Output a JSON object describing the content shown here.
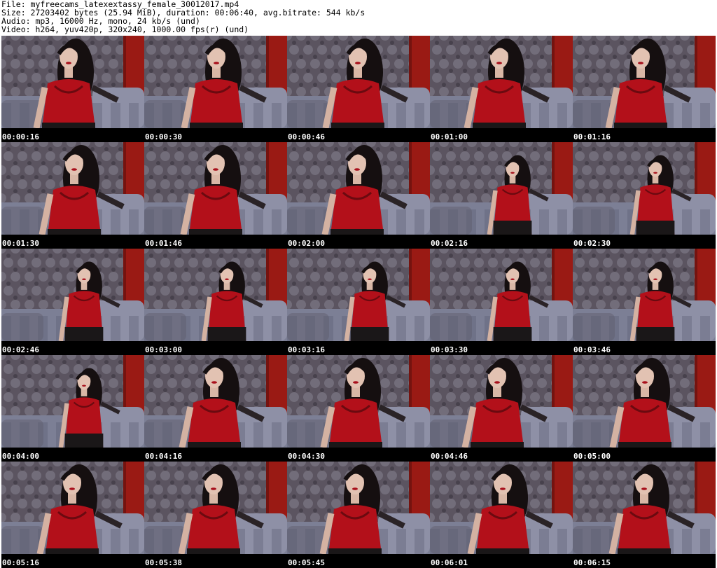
{
  "header": {
    "file_line": "File: myfreecams_latexextassy_female_30012017.mp4",
    "size_line": "Size: 27203402 bytes (25.94 MiB), duration: 00:06:40, avg.bitrate: 544 kb/s",
    "audio_line": "Audio: mp3, 16000 Hz, mono, 24 kb/s (und)",
    "video_line": "Video: h264, yuv420p, 320x240, 1000.00 fps(r) (und)"
  },
  "colors": {
    "sheet_background": "#000000",
    "timestamp_text": "#ffffff",
    "corset_red": "#b3101a",
    "wallpaper_red": "#9a1a14",
    "sofa_gray": "#7c7f95"
  },
  "thumbnails": [
    {
      "timestamp": "00:00:16",
      "figure": "close"
    },
    {
      "timestamp": "00:00:30",
      "figure": "close"
    },
    {
      "timestamp": "00:00:46",
      "figure": "close"
    },
    {
      "timestamp": "00:01:00",
      "figure": "close"
    },
    {
      "timestamp": "00:01:16",
      "figure": "close"
    },
    {
      "timestamp": "00:01:30",
      "figure": "close"
    },
    {
      "timestamp": "00:01:46",
      "figure": "close"
    },
    {
      "timestamp": "00:02:00",
      "figure": "close"
    },
    {
      "timestamp": "00:02:16",
      "figure": "far"
    },
    {
      "timestamp": "00:02:30",
      "figure": "far"
    },
    {
      "timestamp": "00:02:46",
      "figure": "far"
    },
    {
      "timestamp": "00:03:00",
      "figure": "far"
    },
    {
      "timestamp": "00:03:16",
      "figure": "far"
    },
    {
      "timestamp": "00:03:30",
      "figure": "far"
    },
    {
      "timestamp": "00:03:46",
      "figure": "far"
    },
    {
      "timestamp": "00:04:00",
      "figure": "far"
    },
    {
      "timestamp": "00:04:16",
      "figure": "close"
    },
    {
      "timestamp": "00:04:30",
      "figure": "close"
    },
    {
      "timestamp": "00:04:46",
      "figure": "close"
    },
    {
      "timestamp": "00:05:00",
      "figure": "close"
    },
    {
      "timestamp": "00:05:16",
      "figure": "close"
    },
    {
      "timestamp": "00:05:38",
      "figure": "close"
    },
    {
      "timestamp": "00:05:45",
      "figure": "close"
    },
    {
      "timestamp": "00:06:01",
      "figure": "close"
    },
    {
      "timestamp": "00:06:15",
      "figure": "close"
    }
  ]
}
